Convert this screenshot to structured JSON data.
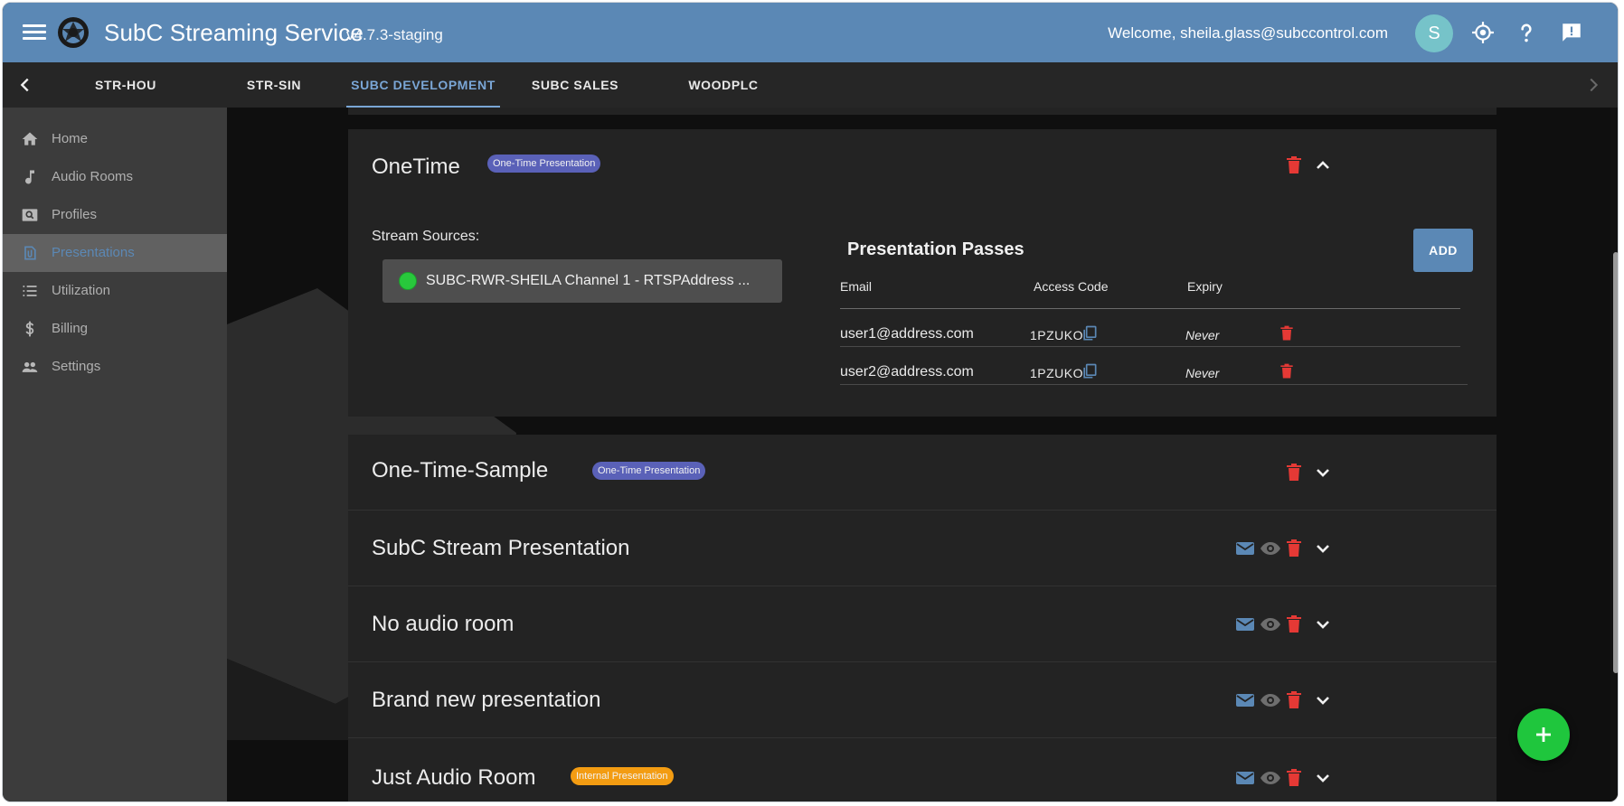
{
  "app": {
    "title": "SubC Streaming Service",
    "version": "v4.7.3-staging",
    "welcome": "Welcome, sheila.glass@subccontrol.com",
    "avatar_letter": "S",
    "accent": "#5b88b5"
  },
  "tabs": [
    {
      "label": "STR-HOU"
    },
    {
      "label": "STR-SIN"
    },
    {
      "label": "SUBC DEVELOPMENT",
      "active": true
    },
    {
      "label": "SUBC SALES"
    },
    {
      "label": "WOODPLC"
    }
  ],
  "sidebar": {
    "items": [
      {
        "label": "Home",
        "icon": "home-icon"
      },
      {
        "label": "Audio Rooms",
        "icon": "music-note-icon"
      },
      {
        "label": "Profiles",
        "icon": "profile-search-icon"
      },
      {
        "label": "Presentations",
        "icon": "attachment-icon",
        "active": true
      },
      {
        "label": "Utilization",
        "icon": "list-icon"
      },
      {
        "label": "Billing",
        "icon": "dollar-icon"
      },
      {
        "label": "Settings",
        "icon": "people-icon"
      }
    ]
  },
  "expanded": {
    "title": "OneTime",
    "badge": "One-Time Presentation",
    "stream_sources_label": "Stream Sources:",
    "source": "SUBC-RWR-SHEILA Channel 1 - RTSPAddress ...",
    "passes_title": "Presentation Passes",
    "add_label": "ADD",
    "columns": [
      "Email",
      "Access Code",
      "Expiry"
    ],
    "passes": [
      {
        "email": "user1@address.com",
        "code": "1PZUKO",
        "expiry": "Never"
      },
      {
        "email": "user2@address.com",
        "code": "1PZUKO",
        "expiry": "Never"
      }
    ]
  },
  "presentations": [
    {
      "title": "One-Time-Sample",
      "badge": "One-Time Presentation",
      "badge_color": "blue"
    },
    {
      "title": "SubC Stream Presentation"
    },
    {
      "title": "No audio room"
    },
    {
      "title": "Brand new presentation"
    },
    {
      "title": "Just Audio Room",
      "badge": "Internal Presentation",
      "badge_color": "orange"
    }
  ],
  "colors": {
    "delete": "#e53935",
    "mail": "#5b88b5",
    "eye": "#6e6e6e",
    "fab": "#1fc63d",
    "live": "#28c83c"
  }
}
